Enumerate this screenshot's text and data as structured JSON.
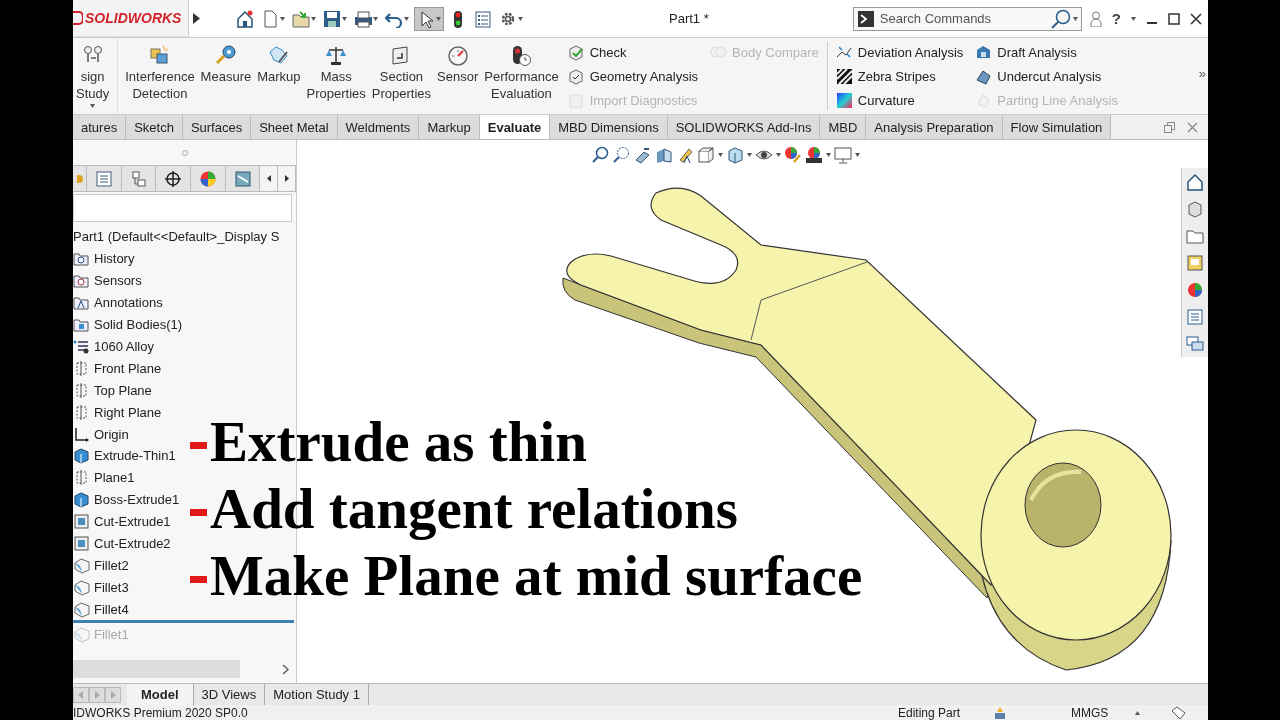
{
  "app": {
    "logo": "SOLIDWORKS",
    "title": "Part1 *",
    "search": {
      "placeholder": "Search Commands"
    },
    "help": "?"
  },
  "ribbon": {
    "large_buttons": [
      {
        "label": "sign Study",
        "dropdown": true
      },
      {
        "label": "Interference Detection",
        "dropdown": false
      },
      {
        "label": "Measure",
        "dropdown": false
      },
      {
        "label": "Markup",
        "dropdown": false
      },
      {
        "label": "Mass Properties",
        "dropdown": false
      },
      {
        "label": "Section Properties",
        "dropdown": false
      },
      {
        "label": "Sensor",
        "dropdown": false
      },
      {
        "label": "Performance Evaluation",
        "dropdown": false
      }
    ],
    "small_columns": [
      [
        {
          "label": "Check",
          "disabled": false
        },
        {
          "label": "Geometry Analysis",
          "disabled": false
        },
        {
          "label": "Import Diagnostics",
          "disabled": true
        }
      ],
      [
        {
          "label": "Body Compare",
          "disabled": true
        }
      ],
      [
        {
          "label": "Deviation Analysis",
          "disabled": false
        },
        {
          "label": "Zebra Stripes",
          "disabled": false
        },
        {
          "label": "Curvature",
          "disabled": false
        }
      ],
      [
        {
          "label": "Draft Analysis",
          "disabled": false
        },
        {
          "label": "Undercut Analysis",
          "disabled": false
        },
        {
          "label": "Parting Line Analysis",
          "disabled": true
        }
      ]
    ],
    "more": "»"
  },
  "tabs": [
    {
      "label": "atures",
      "selected": false
    },
    {
      "label": "Sketch",
      "selected": false
    },
    {
      "label": "Surfaces",
      "selected": false
    },
    {
      "label": "Sheet Metal",
      "selected": false
    },
    {
      "label": "Weldments",
      "selected": false
    },
    {
      "label": "Markup",
      "selected": false
    },
    {
      "label": "Evaluate",
      "selected": true
    },
    {
      "label": "MBD Dimensions",
      "selected": false
    },
    {
      "label": "SOLIDWORKS Add-Ins",
      "selected": false
    },
    {
      "label": "MBD",
      "selected": false
    },
    {
      "label": "Analysis Preparation",
      "selected": false
    },
    {
      "label": "Flow Simulation",
      "selected": false
    }
  ],
  "tree": {
    "root": "Part1  (Default<<Default>_Display S",
    "items": [
      {
        "label": "History",
        "kind": "history",
        "rolled_back": false
      },
      {
        "label": "Sensors",
        "kind": "sensors",
        "rolled_back": false
      },
      {
        "label": "Annotations",
        "kind": "annotations",
        "rolled_back": false
      },
      {
        "label": "Solid Bodies(1)",
        "kind": "bodies",
        "rolled_back": false
      },
      {
        "label": "1060 Alloy",
        "kind": "material",
        "rolled_back": false
      },
      {
        "label": "Front Plane",
        "kind": "plane",
        "rolled_back": false
      },
      {
        "label": "Top Plane",
        "kind": "plane",
        "rolled_back": false
      },
      {
        "label": "Right Plane",
        "kind": "plane",
        "rolled_back": false
      },
      {
        "label": "Origin",
        "kind": "origin",
        "rolled_back": false
      },
      {
        "label": "Extrude-Thin1",
        "kind": "boss",
        "rolled_back": false
      },
      {
        "label": "Plane1",
        "kind": "plane",
        "rolled_back": false
      },
      {
        "label": "Boss-Extrude1",
        "kind": "boss",
        "rolled_back": false
      },
      {
        "label": "Cut-Extrude1",
        "kind": "cut",
        "rolled_back": false
      },
      {
        "label": "Cut-Extrude2",
        "kind": "cut",
        "rolled_back": false
      },
      {
        "label": "Fillet2",
        "kind": "fillet",
        "rolled_back": false
      },
      {
        "label": "Fillet3",
        "kind": "fillet",
        "rolled_back": false
      },
      {
        "label": "Fillet4",
        "kind": "fillet",
        "rolled_back": false
      },
      {
        "label": "Fillet1",
        "kind": "fillet",
        "rolled_back": true
      }
    ]
  },
  "overlay": {
    "lines": [
      "Extrude as thin",
      "Add tangent relations",
      "Make Plane at mid surface"
    ]
  },
  "bottom_tabs": [
    {
      "label": "Model",
      "selected": true
    },
    {
      "label": "3D Views",
      "selected": false
    },
    {
      "label": "Motion Study 1",
      "selected": false
    }
  ],
  "status_bar": {
    "product": "IDWORKS Premium 2020 SP0.0",
    "mode": "Editing Part",
    "units": "MMGS"
  }
}
